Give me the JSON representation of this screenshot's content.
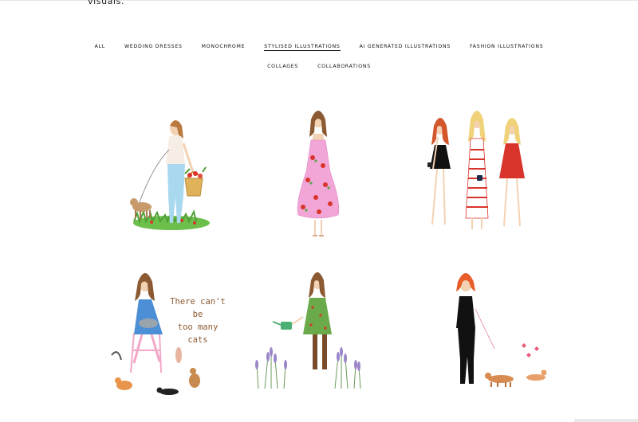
{
  "intro": {
    "text": "visuals."
  },
  "nav": {
    "row1": [
      {
        "label": "ALL",
        "active": false
      },
      {
        "label": "WEDDING DRESSES",
        "active": false
      },
      {
        "label": "MONOCHROME",
        "active": false
      },
      {
        "label": "STYLISED ILLUSTRATIONS",
        "active": true
      },
      {
        "label": "AI GENERATED ILLUSTRATIONS",
        "active": false
      },
      {
        "label": "FASHION ILLUSTRATIONS",
        "active": false
      }
    ],
    "row2": [
      {
        "label": "COLLAGES",
        "active": false
      },
      {
        "label": "COLLABORATIONS",
        "active": false
      }
    ]
  },
  "gallery": {
    "tiles": [
      {
        "icon": "girl-walking-dog-illustration"
      },
      {
        "icon": "girl-in-floral-gown-illustration"
      },
      {
        "icon": "three-women-illustration"
      },
      {
        "icon": "girl-with-cats-illustration",
        "caption": [
          "There can't",
          "be",
          "too many",
          "cats"
        ]
      },
      {
        "icon": "girl-watering-lavender-illustration"
      },
      {
        "icon": "girl-with-dachshunds-illustration"
      }
    ]
  },
  "colors": {
    "accent": "#111111",
    "grass": "#6cbf4a",
    "dress_pink": "#f2a6d8",
    "red": "#d9342b"
  }
}
